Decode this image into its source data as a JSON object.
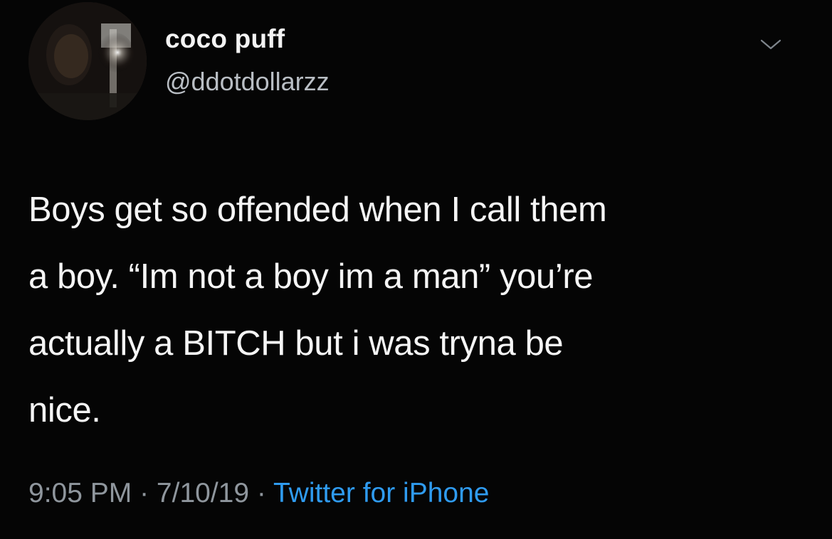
{
  "profile": {
    "display_name": "coco puff",
    "handle": "@ddotdollarzz",
    "avatar_icon": "profile-photo"
  },
  "tweet": {
    "text": "Boys get so offended when I call them\na boy. “Im not a boy im a man” you’re\nactually a BITCH but i was tryna be\nnice."
  },
  "meta": {
    "time": "9:05 PM",
    "separator_1": " · ",
    "date": "7/10/19",
    "separator_2": " · ",
    "source": "Twitter for iPhone"
  },
  "actions": {
    "menu_icon": "chevron-down-icon"
  },
  "colors": {
    "background": "#000000",
    "primary_text": "#f5f5f5",
    "secondary_text": "#8f969d",
    "accent": "#2f9bf0"
  }
}
